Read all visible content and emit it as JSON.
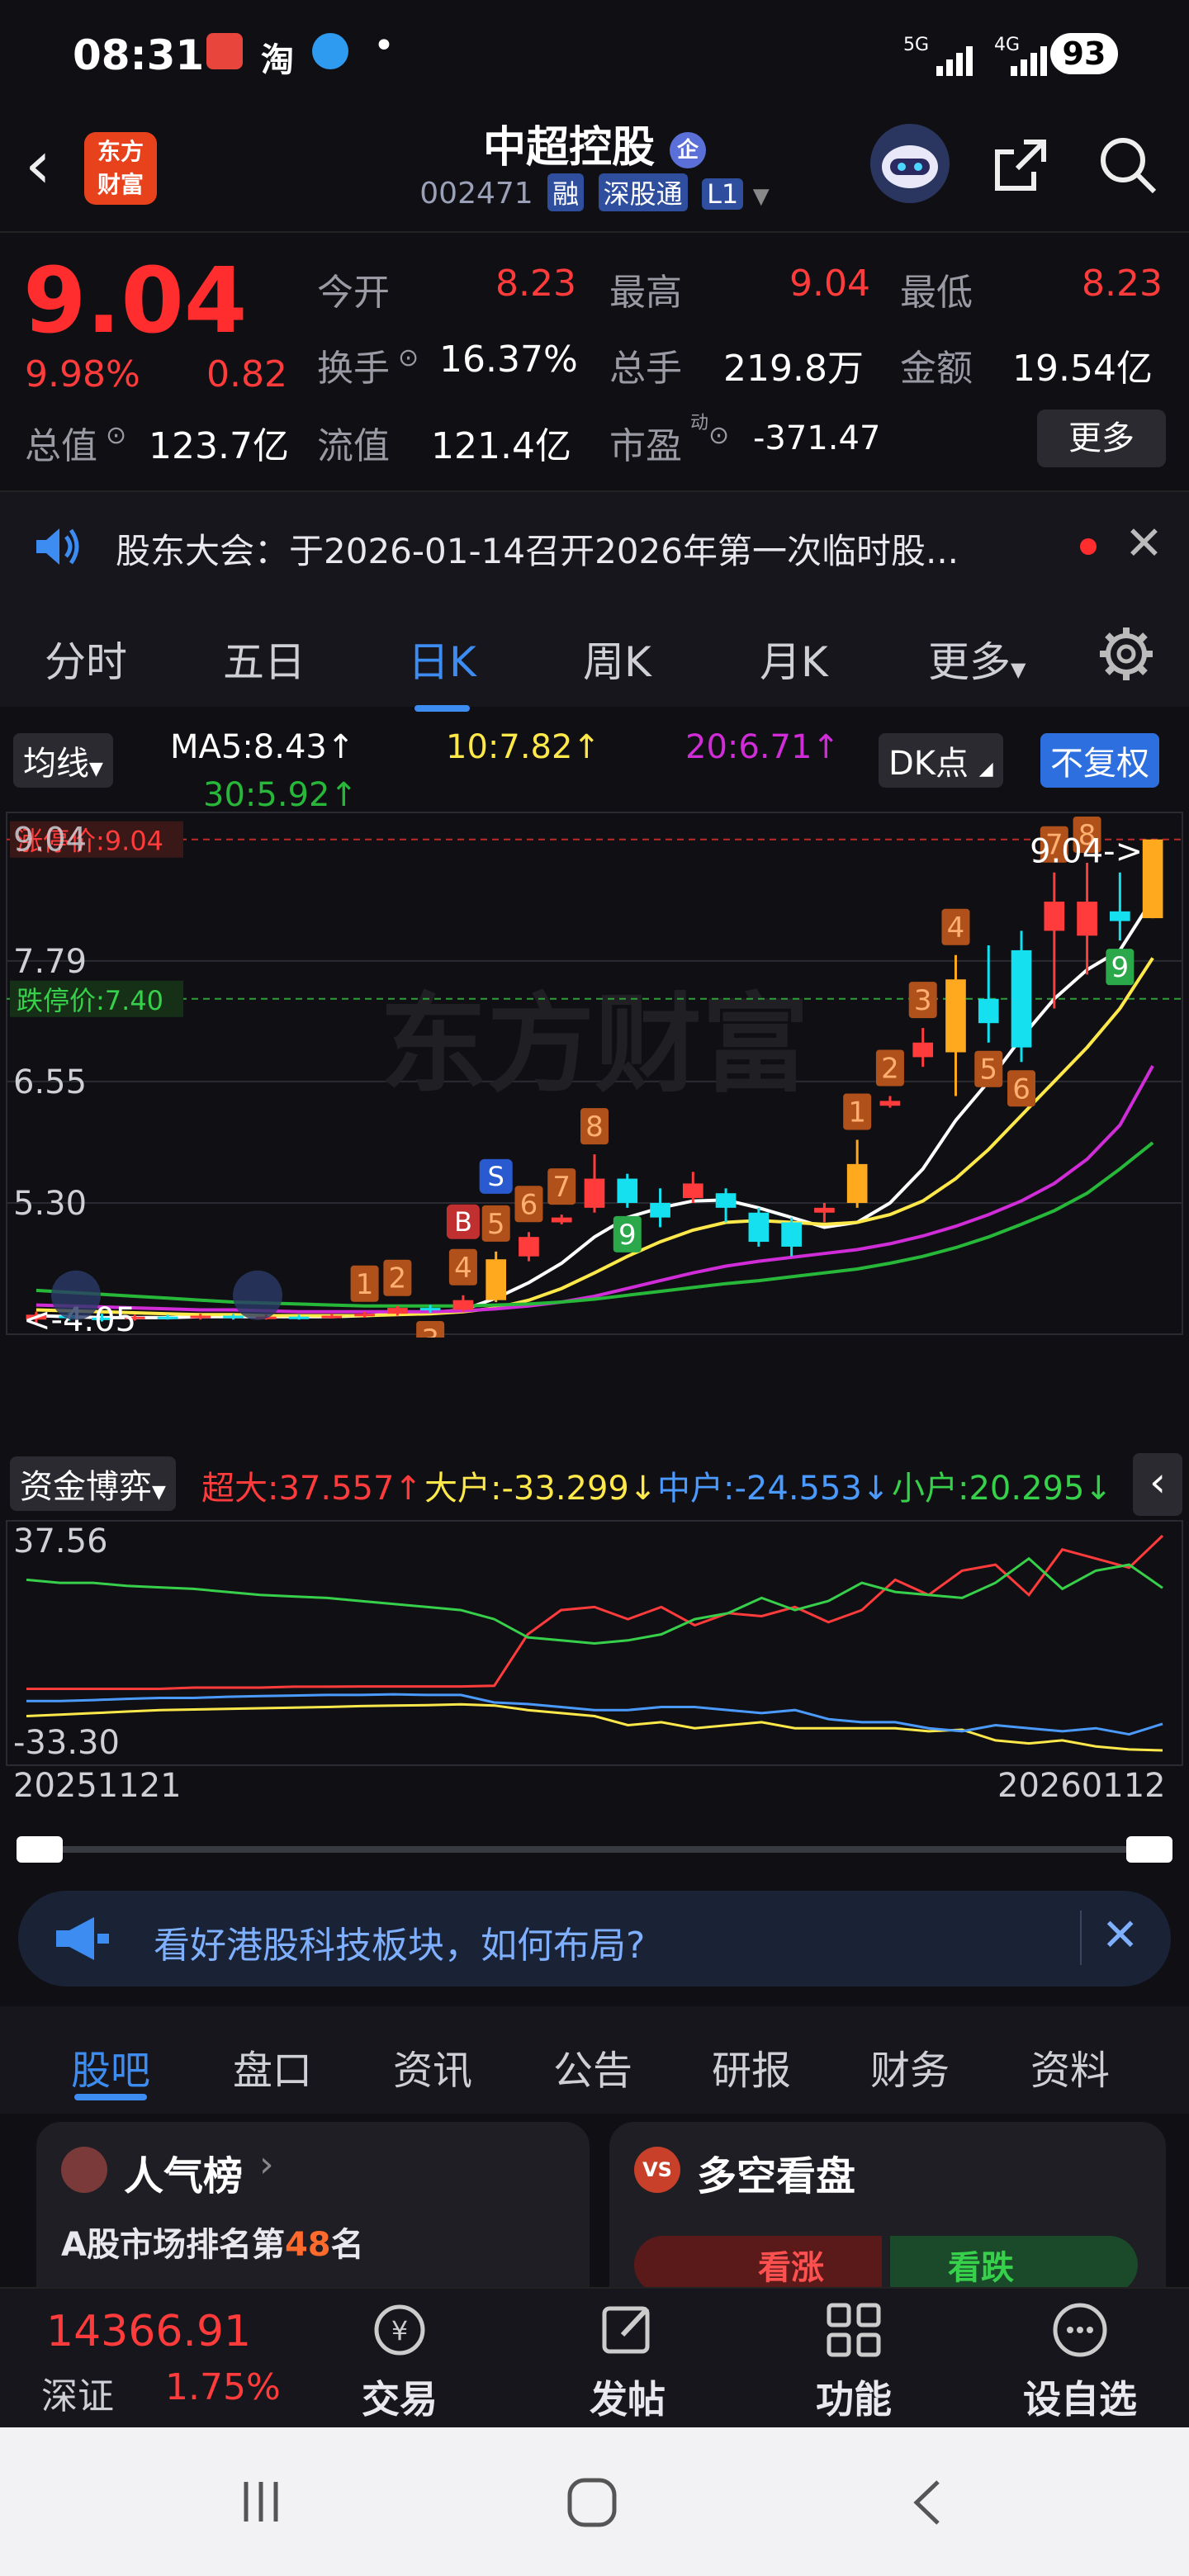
{
  "status_bar": {
    "time": "08:31",
    "app_icons": [
      "calendar-app-icon",
      "taobao-icon",
      "qq-icon"
    ],
    "taobao_label": "淘",
    "dot": "•",
    "signal1": "5G",
    "signal2": "4G",
    "battery": "93"
  },
  "header": {
    "logo_line1": "东方",
    "logo_line2": "财富",
    "name": "中超控股",
    "name_badge": "企",
    "code": "002471",
    "tags": [
      "融",
      "深股通",
      "L1"
    ]
  },
  "quote": {
    "price": "9.04",
    "change_pct": "9.98%",
    "change": "0.82",
    "open_label": "今开",
    "open": "8.23",
    "high_label": "最高",
    "high": "9.04",
    "low_label": "最低",
    "low": "8.23",
    "turnover_label": "换手",
    "turnover": "16.37%",
    "volume_label": "总手",
    "volume": "219.8万",
    "amount_label": "金额",
    "amount": "19.54亿",
    "mktcap_label": "总值",
    "mktcap": "123.7亿",
    "float_label": "流值",
    "float": "121.4亿",
    "pe_label": "市盈",
    "pe_sup": "动",
    "pe": "-371.47",
    "more_button": "更多"
  },
  "notice": {
    "text": "股东大会：于2026-01-14召开2026年第一次临时股..."
  },
  "k_tabs": [
    "分时",
    "五日",
    "日K",
    "周K",
    "月K",
    "更多"
  ],
  "k_tab_active": 2,
  "ma_bar": {
    "selector": "均线",
    "ma5": "MA5:8.43",
    "ma10": "10:7.82",
    "ma20": "20:6.71",
    "ma30": "30:5.92",
    "dk_button": "DK点",
    "adjust_button": "不复权"
  },
  "chart_data": [
    {
      "type": "candlestick",
      "y_tick_labels": [
        "7.79",
        "6.55",
        "5.30"
      ],
      "ylim": [
        4.0,
        9.25
      ],
      "limit_up_label": "涨停价:9.04",
      "limit_down_label": "跌停价:7.40",
      "top_price_label": "9.04",
      "last_price_pointer": "9.04->",
      "low_marker": "<-4.05",
      "watermark": "东方财富",
      "candles": [
        {
          "o": 4.1,
          "c": 4.15,
          "h": 4.18,
          "l": 4.06,
          "n": ""
        },
        {
          "o": 4.14,
          "c": 4.12,
          "h": 4.17,
          "l": 4.09,
          "n": ""
        },
        {
          "o": 4.12,
          "c": 4.11,
          "h": 4.16,
          "l": 4.08,
          "n": ""
        },
        {
          "o": 4.11,
          "c": 4.13,
          "h": 4.15,
          "l": 4.09,
          "n": ""
        },
        {
          "o": 4.13,
          "c": 4.12,
          "h": 4.15,
          "l": 4.1,
          "n": ""
        },
        {
          "o": 4.12,
          "c": 4.14,
          "h": 4.16,
          "l": 4.1,
          "n": ""
        },
        {
          "o": 4.14,
          "c": 4.12,
          "h": 4.16,
          "l": 4.1,
          "n": ""
        },
        {
          "o": 4.12,
          "c": 4.13,
          "h": 4.15,
          "l": 4.1,
          "n": ""
        },
        {
          "o": 4.13,
          "c": 4.12,
          "h": 4.15,
          "l": 4.1,
          "n": ""
        },
        {
          "o": 4.12,
          "c": 4.14,
          "h": 4.16,
          "l": 4.11,
          "n": ""
        },
        {
          "o": 4.14,
          "c": 4.16,
          "h": 4.18,
          "l": 4.12,
          "n": "1"
        },
        {
          "o": 4.16,
          "c": 4.22,
          "h": 4.24,
          "l": 4.14,
          "n": "2"
        },
        {
          "o": 4.22,
          "c": 4.2,
          "h": 4.25,
          "l": 4.17,
          "n": "3"
        },
        {
          "o": 4.2,
          "c": 4.3,
          "h": 4.35,
          "l": 4.18,
          "n": "4"
        },
        {
          "o": 4.3,
          "c": 4.72,
          "h": 4.8,
          "l": 4.28,
          "n": "5"
        },
        {
          "o": 4.75,
          "c": 4.95,
          "h": 5.0,
          "l": 4.7,
          "n": "6"
        },
        {
          "o": 5.1,
          "c": 5.15,
          "h": 5.18,
          "l": 5.08,
          "n": "7"
        },
        {
          "o": 5.25,
          "c": 5.55,
          "h": 5.8,
          "l": 5.2,
          "n": "8"
        },
        {
          "o": 5.55,
          "c": 5.3,
          "h": 5.6,
          "l": 5.25,
          "n": "9"
        },
        {
          "o": 5.3,
          "c": 5.15,
          "h": 5.45,
          "l": 5.05,
          "n": ""
        },
        {
          "o": 5.35,
          "c": 5.5,
          "h": 5.62,
          "l": 5.3,
          "n": ""
        },
        {
          "o": 5.4,
          "c": 5.25,
          "h": 5.45,
          "l": 5.1,
          "n": ""
        },
        {
          "o": 5.2,
          "c": 4.9,
          "h": 5.25,
          "l": 4.85,
          "n": ""
        },
        {
          "o": 5.1,
          "c": 4.85,
          "h": 5.15,
          "l": 4.75,
          "n": ""
        },
        {
          "o": 5.2,
          "c": 5.25,
          "h": 5.3,
          "l": 5.1,
          "n": ""
        },
        {
          "o": 5.3,
          "c": 5.7,
          "h": 5.95,
          "l": 5.25,
          "n": "1"
        },
        {
          "o": 6.3,
          "c": 6.35,
          "h": 6.4,
          "l": 6.28,
          "n": "2"
        },
        {
          "o": 6.8,
          "c": 6.95,
          "h": 7.1,
          "l": 6.7,
          "n": "3"
        },
        {
          "o": 6.85,
          "c": 7.6,
          "h": 7.85,
          "l": 6.4,
          "n": "4"
        },
        {
          "o": 7.4,
          "c": 7.15,
          "h": 7.95,
          "l": 6.95,
          "n": "5"
        },
        {
          "o": 7.9,
          "c": 6.9,
          "h": 8.1,
          "l": 6.75,
          "n": "6"
        },
        {
          "o": 8.1,
          "c": 8.4,
          "h": 8.7,
          "l": 7.3,
          "n": "7"
        },
        {
          "o": 8.05,
          "c": 8.4,
          "h": 8.8,
          "l": 7.65,
          "n": "8"
        },
        {
          "o": 8.3,
          "c": 8.2,
          "h": 8.7,
          "l": 8.0,
          "n": "9"
        },
        {
          "o": 8.23,
          "c": 9.04,
          "h": 9.04,
          "l": 8.23,
          "n": ""
        }
      ],
      "ma_lines": {
        "ma5": [
          4.14,
          4.13,
          4.12,
          4.12,
          4.12,
          4.13,
          4.13,
          4.13,
          4.13,
          4.13,
          4.14,
          4.16,
          4.17,
          4.2,
          4.32,
          4.48,
          4.68,
          4.95,
          5.15,
          5.25,
          5.32,
          5.33,
          5.25,
          5.15,
          5.05,
          5.1,
          5.3,
          5.65,
          6.15,
          6.55,
          7.0,
          7.4,
          7.7,
          7.9,
          8.43
        ],
        "ma10": [
          4.2,
          4.19,
          4.18,
          4.17,
          4.16,
          4.15,
          4.15,
          4.14,
          4.14,
          4.14,
          4.14,
          4.15,
          4.16,
          4.18,
          4.22,
          4.3,
          4.42,
          4.58,
          4.75,
          4.9,
          5.02,
          5.1,
          5.12,
          5.1,
          5.08,
          5.1,
          5.18,
          5.32,
          5.55,
          5.85,
          6.2,
          6.55,
          6.9,
          7.3,
          7.82
        ],
        "ma20": [
          4.25,
          4.24,
          4.23,
          4.22,
          4.21,
          4.2,
          4.2,
          4.19,
          4.18,
          4.18,
          4.18,
          4.18,
          4.18,
          4.19,
          4.21,
          4.24,
          4.28,
          4.34,
          4.42,
          4.5,
          4.58,
          4.65,
          4.7,
          4.74,
          4.78,
          4.82,
          4.88,
          4.96,
          5.06,
          5.18,
          5.32,
          5.5,
          5.75,
          6.1,
          6.71
        ],
        "ma30": [
          4.4,
          4.38,
          4.36,
          4.34,
          4.32,
          4.3,
          4.28,
          4.27,
          4.26,
          4.25,
          4.24,
          4.24,
          4.24,
          4.24,
          4.25,
          4.26,
          4.28,
          4.31,
          4.35,
          4.39,
          4.43,
          4.47,
          4.5,
          4.54,
          4.58,
          4.62,
          4.68,
          4.75,
          4.84,
          4.95,
          5.08,
          5.22,
          5.4,
          5.65,
          5.92
        ]
      },
      "signal_badges": {
        "buy": "B",
        "sell": "S"
      }
    },
    {
      "type": "line",
      "selector": "资金博弈",
      "y_tick_labels": [
        "37.56",
        "-33.30"
      ],
      "ylim": [
        -33.3,
        37.56
      ],
      "x_start": "20251121",
      "x_end": "20260112",
      "series": [
        {
          "name": "超大",
          "value": "37.557",
          "color": "#ff3b3b",
          "values": [
            -13,
            -13,
            -13,
            -13,
            -13,
            -12.6,
            -12.6,
            -12.6,
            -12.3,
            -12.3,
            -12.2,
            -12.2,
            -12.2,
            -12.2,
            -12,
            5,
            13,
            14,
            10,
            14,
            8,
            12,
            11,
            14,
            9,
            13,
            23,
            18,
            26,
            28,
            18,
            33,
            30,
            27,
            37.557
          ]
        },
        {
          "name": "大户",
          "value": "-33.299",
          "color": "#ffe84a",
          "values": [
            -22,
            -21.5,
            -21,
            -20.5,
            -20,
            -19.8,
            -19.6,
            -19.4,
            -19.2,
            -19,
            -18.7,
            -18.5,
            -18.4,
            -18.1,
            -18.5,
            -20,
            -21,
            -22,
            -25,
            -24,
            -26,
            -25,
            -24,
            -26,
            -26,
            -26,
            -26,
            -27,
            -26.5,
            -30,
            -31,
            -30,
            -32,
            -33,
            -33.3
          ]
        },
        {
          "name": "中户",
          "value": "-24.553",
          "color": "#4b9aff",
          "values": [
            -17,
            -17,
            -16.7,
            -16.3,
            -16,
            -16,
            -15.6,
            -15.4,
            -15.2,
            -15,
            -15,
            -14.8,
            -15,
            -15,
            -17.5,
            -18,
            -19,
            -20,
            -20,
            -19,
            -19,
            -20,
            -21,
            -20,
            -23,
            -24,
            -24,
            -26,
            -27,
            -25,
            -26,
            -27,
            -26,
            -28,
            -24.553
          ]
        },
        {
          "name": "小户",
          "value": "20.295",
          "color": "#37d04a",
          "values": [
            23,
            22,
            22,
            21,
            20.5,
            20,
            19,
            18,
            17.5,
            17,
            16,
            15,
            14,
            13,
            10,
            4,
            3,
            2,
            3,
            5,
            10,
            12,
            17,
            13,
            16,
            22,
            19,
            18,
            17,
            22,
            30,
            20,
            26,
            28,
            20.295
          ]
        }
      ]
    }
  ],
  "promo": {
    "text": "看好港股科技板块，如何布局?"
  },
  "bottom_tabs": [
    "股吧",
    "盘口",
    "资讯",
    "公告",
    "研报",
    "财务",
    "资料"
  ],
  "bottom_tab_active": 0,
  "cards": {
    "left_title": "人气榜",
    "left_rank_prefix": "A股市场排名第",
    "left_rank_num": "48",
    "left_rank_suffix": "名",
    "left_badge": "VS",
    "right_title": "多空看盘",
    "bull": "看涨",
    "bear": "看跌"
  },
  "footer": {
    "index_value": "14366.91",
    "index_name": "深证",
    "index_change": "1.75%",
    "items": [
      "交易",
      "发帖",
      "功能",
      "设自选"
    ]
  },
  "colors": {
    "up": "#ff3b3b",
    "down": "#15e0f0",
    "ma5": "#ffffff",
    "ma10": "#ffe84a",
    "ma20": "#d02cd8",
    "ma30": "#27b83a",
    "accent": "#3d8cf2"
  }
}
